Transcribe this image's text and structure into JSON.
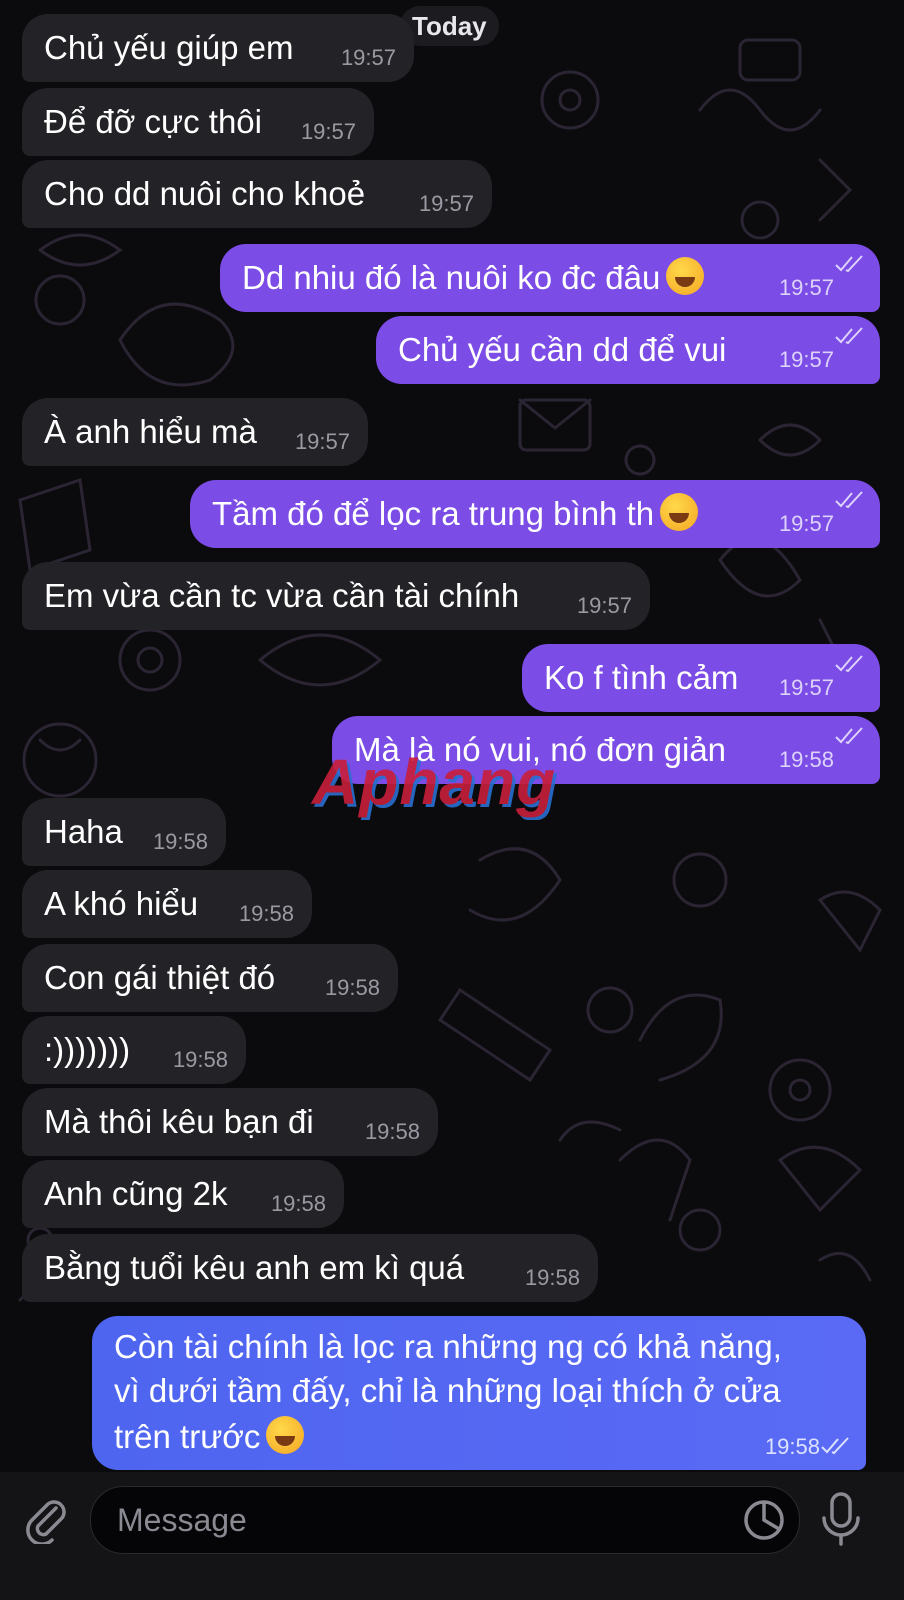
{
  "date_label": "Today",
  "watermark": "Aphang",
  "messages": [
    {
      "text": "Chủ yếu giúp em",
      "time": "19:57"
    },
    {
      "text": "Để đỡ cực thôi",
      "time": "19:57"
    },
    {
      "text": "Cho dd nuôi cho khoẻ",
      "time": "19:57"
    },
    {
      "text": "Dd nhiu đó là nuôi ko đc đâu",
      "time": "19:57"
    },
    {
      "text": "Chủ yếu cần dd để vui",
      "time": "19:57"
    },
    {
      "text": "À anh hiểu mà",
      "time": "19:57"
    },
    {
      "text": "Tầm đó để lọc ra trung bình th",
      "time": "19:57"
    },
    {
      "text": "Em vừa cần tc vừa cần tài chính",
      "time": "19:57"
    },
    {
      "text": "Ko f tình cảm",
      "time": "19:57"
    },
    {
      "text": "Mà là nó vui, nó đơn giản",
      "time": "19:58"
    },
    {
      "text": "Haha",
      "time": "19:58"
    },
    {
      "text": "A khó hiểu",
      "time": "19:58"
    },
    {
      "text": "Con gái thiệt đó",
      "time": "19:58"
    },
    {
      "text": ":)))))))",
      "time": "19:58"
    },
    {
      "text": "Mà thôi kêu bạn đi",
      "time": "19:58"
    },
    {
      "text": "Anh cũng 2k",
      "time": "19:58"
    },
    {
      "text": "Bằng tuổi kêu anh em kì quá",
      "time": "19:58"
    }
  ],
  "last_message": {
    "lines": [
      "Còn tài chính là lọc ra những ng có khả năng,",
      "vì dưới tầm đấy, chỉ là những loại thích ở cửa",
      "trên trước"
    ],
    "time": "19:58"
  },
  "composer": {
    "placeholder": "Message"
  },
  "icons": [
    "paperclip-icon",
    "sticker-icon",
    "microphone-icon",
    "double-check-icon",
    "laughing-emoji-icon"
  ],
  "colors": {
    "incoming": "#232227",
    "outgoing": "#7b4ce6",
    "outgoing_last": "#5066f2",
    "background": "#0b0b0e"
  }
}
